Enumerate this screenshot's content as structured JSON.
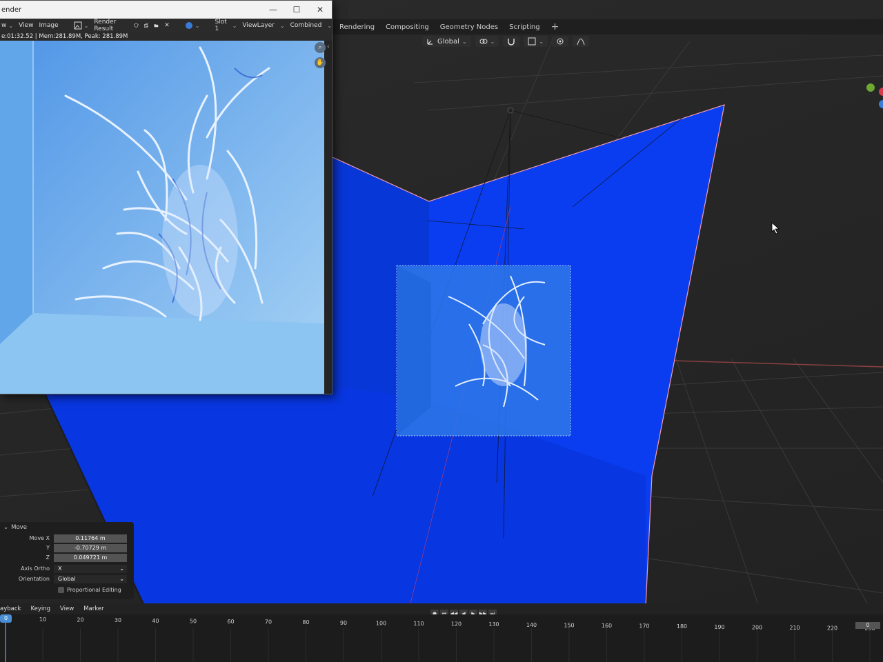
{
  "render_window": {
    "title": "ender",
    "menu": {
      "view_partial": "w",
      "view": "View",
      "image": "Image",
      "render_result": "Render Result",
      "slot": "Slot 1",
      "view_layer": "ViewLayer",
      "pass": "Combined"
    },
    "status": "e:01:32.52 | Mem:281.89M, Peak: 281.89M"
  },
  "workspace_tabs": [
    "Rendering",
    "Compositing",
    "Geometry Nodes",
    "Scripting"
  ],
  "viewport_header": {
    "orientation": "Global"
  },
  "redo_panel": {
    "title": "Move",
    "rows": [
      {
        "label": "Move X",
        "value": "0.11764 m"
      },
      {
        "label": "Y",
        "value": "-0.70729 m"
      },
      {
        "label": "Z",
        "value": "0.049721 m"
      }
    ],
    "axis_ortho_label": "Axis Ortho",
    "axis_ortho_value": "X",
    "orientation_label": "Orientation",
    "orientation_value": "Global",
    "proportional_label": "Proportional Editing"
  },
  "timeline": {
    "menus": [
      "ayback",
      "Keying",
      "View",
      "Marker"
    ],
    "current_frame": "0",
    "playhead_label": "0",
    "ticks": [
      "10",
      "20",
      "30",
      "40",
      "50",
      "60",
      "70",
      "80",
      "90",
      "100",
      "110",
      "120",
      "130",
      "140",
      "150",
      "160",
      "170",
      "180",
      "190",
      "200",
      "210",
      "220",
      "230"
    ]
  },
  "colors": {
    "wall_blue": "#0a3df0",
    "render_bg": "#7db8f0",
    "accent": "#4a8fd6"
  }
}
